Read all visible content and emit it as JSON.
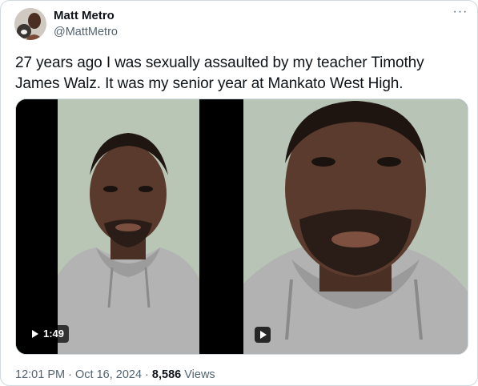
{
  "author": {
    "name": "Matt Metro",
    "handle": "@MattMetro",
    "avatar_icon": "profile-avatar",
    "more_icon": "more-options-icon"
  },
  "tweet": {
    "text": "27 years ago I was sexually assaulted by my teacher Timothy James Walz. It was my senior year at Mankato West High."
  },
  "media": {
    "videos": [
      {
        "duration": "1:49",
        "badge_icon": "play-icon"
      },
      {
        "duration": "",
        "badge_icon": "play-icon"
      }
    ]
  },
  "meta": {
    "time": "12:01 PM",
    "separator": "·",
    "date": "Oct 16, 2024",
    "views_count": "8,586",
    "views_label": "Views"
  },
  "colors": {
    "text": "#0f1419",
    "secondary": "#536471",
    "border": "#cfd9de",
    "background": "#ffffff"
  }
}
